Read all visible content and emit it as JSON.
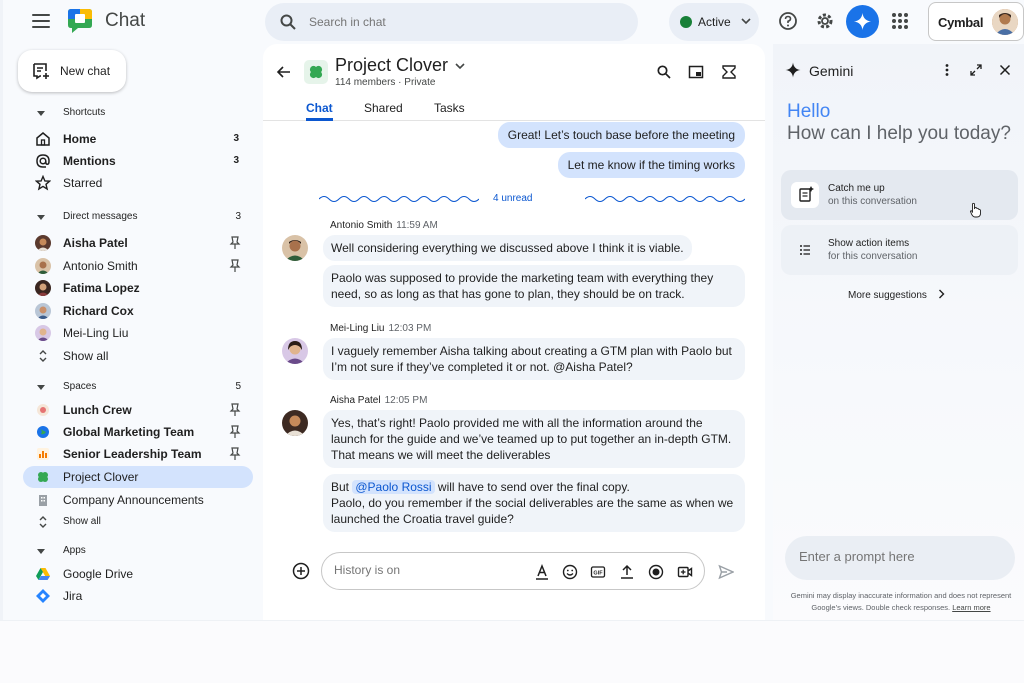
{
  "app": {
    "title": "Chat"
  },
  "search": {
    "placeholder": "Search in chat"
  },
  "status": {
    "label": "Active"
  },
  "account": {
    "org": "Cymbal"
  },
  "sidebar": {
    "new_chat": "New chat",
    "shortcuts": {
      "label": "Shortcuts",
      "items": [
        {
          "label": "Home",
          "count": "3",
          "icon": "home-icon"
        },
        {
          "label": "Mentions",
          "count": "3",
          "icon": "at-icon"
        },
        {
          "label": "Starred",
          "count": "",
          "icon": "star-icon"
        }
      ]
    },
    "direct_messages": {
      "label": "Direct messages",
      "count": "3",
      "items": [
        {
          "label": "Aisha Patel",
          "bold": true
        },
        {
          "label": "Antonio Smith",
          "bold": false
        },
        {
          "label": "Fatima Lopez",
          "bold": true
        },
        {
          "label": "Richard Cox",
          "bold": true
        },
        {
          "label": "Mei-Ling Liu",
          "bold": false
        }
      ],
      "show_all": "Show all"
    },
    "spaces": {
      "label": "Spaces",
      "count": "5",
      "items": [
        {
          "label": "Lunch Crew",
          "bold": true
        },
        {
          "label": "Global Marketing Team",
          "bold": true
        },
        {
          "label": "Senior Leadership Team",
          "bold": true
        },
        {
          "label": "Project Clover",
          "bold": false,
          "active": true
        },
        {
          "label": "Company Announcements",
          "bold": false
        }
      ],
      "show_all": "Show all"
    },
    "apps": {
      "label": "Apps",
      "items": [
        {
          "label": "Google Drive"
        },
        {
          "label": "Jira"
        }
      ]
    }
  },
  "room": {
    "title": "Project Clover",
    "subtitle": "114 members · Private",
    "tabs": [
      "Chat",
      "Shared",
      "Tasks"
    ]
  },
  "messages": {
    "mine": [
      "Great! Let’s touch base before the meeting",
      "Let me know if the timing works"
    ],
    "unread": "4 unread",
    "threads": [
      {
        "sender": "Antonio Smith",
        "time": "11:59 AM",
        "bubbles": [
          "Well considering everything we discussed above I think it is viable.",
          "Paolo was supposed to provide the marketing team with everything they need, so as long as that has gone to plan, they should be on track."
        ]
      },
      {
        "sender": "Mei-Ling Liu",
        "time": "12:03 PM",
        "bubbles": [
          "I vaguely remember Aisha talking about creating a GTM plan with Paolo but I’m not sure if they’ve completed it or not.  @Aisha Patel?"
        ]
      },
      {
        "sender": "Aisha Patel",
        "time": "12:05 PM",
        "bubbles": [
          "Yes, that’s right! Paolo provided me with all the information around the launch for the guide and we’ve teamed up to put together an in-depth GTM. That means we will meet the deliverables"
        ],
        "mention_bubble": {
          "before": "But ",
          "mention": "@Paolo Rossi",
          "after": " will have to send over the final copy.",
          "line2": "Paolo, do you remember if the social deliverables are the same as when we launched the Croatia travel guide?"
        }
      }
    ]
  },
  "composer": {
    "placeholder": "History is on"
  },
  "gemini": {
    "title": "Gemini",
    "hello": "Hello",
    "help": "How can I help you today?",
    "cards": [
      {
        "title": "Catch me up",
        "sub": "on this conversation"
      },
      {
        "title": "Show action items",
        "sub": "for this conversation"
      }
    ],
    "more": "More suggestions",
    "prompt_placeholder": "Enter a prompt here",
    "disclaimer": "Gemini may display inaccurate information and does not represent Google’s views. Double check responses.",
    "learn_more": "Learn more"
  },
  "colors": {
    "accent": "#0b57d0",
    "active_bg": "#d3e3fd",
    "status_green": "#188038"
  }
}
